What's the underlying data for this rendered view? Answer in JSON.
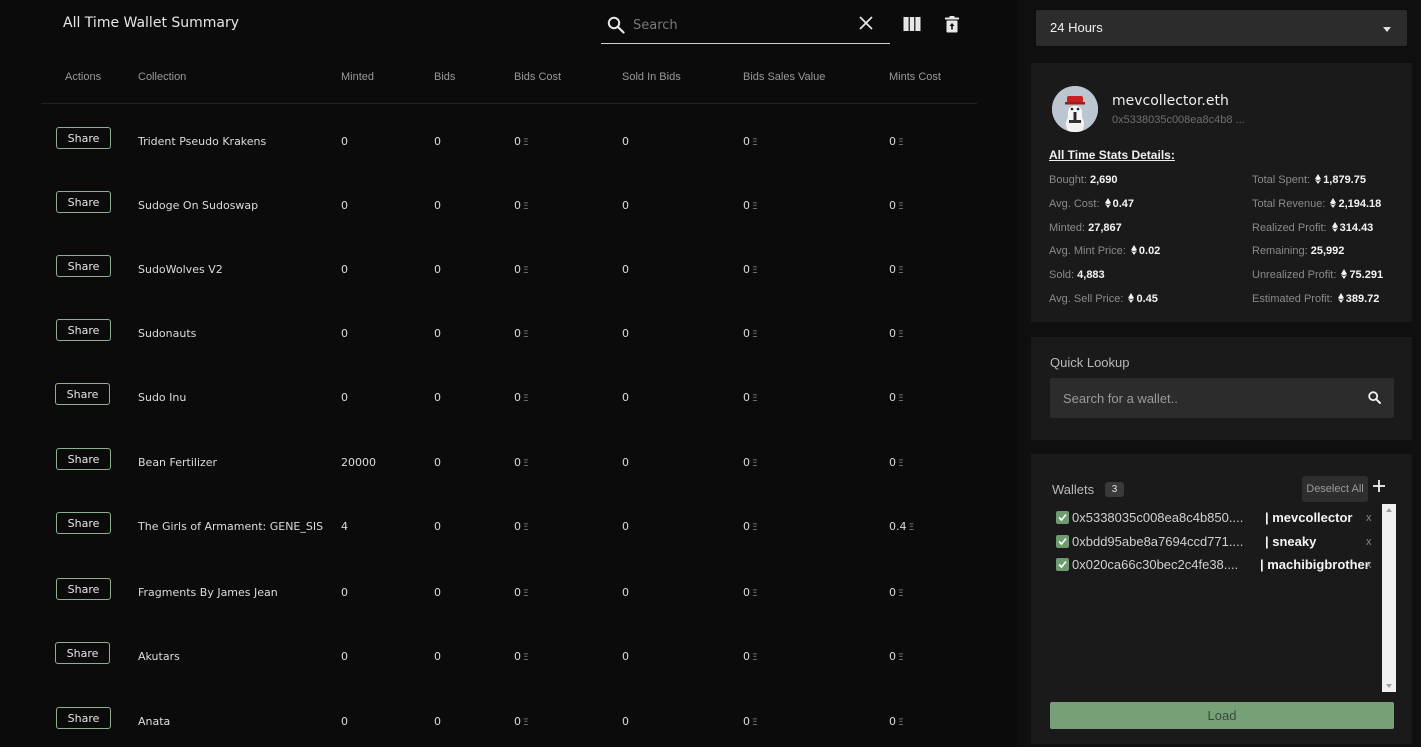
{
  "summary": {
    "title": "All Time Wallet Summary",
    "search_placeholder": "Search"
  },
  "table": {
    "headers": [
      "Actions",
      "Collection",
      "Minted",
      "Bids",
      "Bids Cost",
      "Sold In Bids",
      "Bids Sales Value",
      "Mints Cost"
    ],
    "share_label": "Share",
    "eth_symbol": "Ξ",
    "rows": [
      {
        "collection": "Trident Pseudo Krakens",
        "minted": "0",
        "bids": "0",
        "bids_cost": "0",
        "sold_in_bids": "0",
        "bids_sales_value": "0",
        "mints_cost": "0"
      },
      {
        "collection": "Sudoge On Sudoswap",
        "minted": "0",
        "bids": "0",
        "bids_cost": "0",
        "sold_in_bids": "0",
        "bids_sales_value": "0",
        "mints_cost": "0"
      },
      {
        "collection": "SudoWolves V2",
        "minted": "0",
        "bids": "0",
        "bids_cost": "0",
        "sold_in_bids": "0",
        "bids_sales_value": "0",
        "mints_cost": "0"
      },
      {
        "collection": "Sudonauts",
        "minted": "0",
        "bids": "0",
        "bids_cost": "0",
        "sold_in_bids": "0",
        "bids_sales_value": "0",
        "mints_cost": "0"
      },
      {
        "collection": "Sudo Inu",
        "minted": "0",
        "bids": "0",
        "bids_cost": "0",
        "sold_in_bids": "0",
        "bids_sales_value": "0",
        "mints_cost": "0"
      },
      {
        "collection": "Bean Fertilizer",
        "minted": "20000",
        "bids": "0",
        "bids_cost": "0",
        "sold_in_bids": "0",
        "bids_sales_value": "0",
        "mints_cost": "0"
      },
      {
        "collection": "The Girls of Armament: GENE_SIS",
        "minted": "4",
        "bids": "0",
        "bids_cost": "0",
        "sold_in_bids": "0",
        "bids_sales_value": "0",
        "mints_cost": "0.4"
      },
      {
        "collection": "Fragments By James Jean",
        "minted": "0",
        "bids": "0",
        "bids_cost": "0",
        "sold_in_bids": "0",
        "bids_sales_value": "0",
        "mints_cost": "0"
      },
      {
        "collection": "Akutars",
        "minted": "0",
        "bids": "0",
        "bids_cost": "0",
        "sold_in_bids": "0",
        "bids_sales_value": "0",
        "mints_cost": "0"
      },
      {
        "collection": "Anata",
        "minted": "0",
        "bids": "0",
        "bids_cost": "0",
        "sold_in_bids": "0",
        "bids_sales_value": "0",
        "mints_cost": "0"
      }
    ]
  },
  "period": {
    "selected": "24 Hours"
  },
  "profile": {
    "ens": "mevcollector.eth",
    "address": "0x5338035c008ea8c4b8 ...",
    "stats_title": "All Time Stats Details:",
    "left_stats": [
      {
        "label": "Bought:",
        "value": "2,690",
        "eth": false
      },
      {
        "label": "Avg. Cost:",
        "value": "0.47",
        "eth": true
      },
      {
        "label": "Minted:",
        "value": "27,867",
        "eth": false
      },
      {
        "label": "Avg. Mint Price:",
        "value": "0.02",
        "eth": true
      },
      {
        "label": "Sold:",
        "value": "4,883",
        "eth": false
      },
      {
        "label": "Avg. Sell Price:",
        "value": "0.45",
        "eth": true
      }
    ],
    "right_stats": [
      {
        "label": "Total Spent:",
        "value": "1,879.75",
        "eth": true
      },
      {
        "label": "Total Revenue:",
        "value": "2,194.18",
        "eth": true
      },
      {
        "label": "Realized Profit:",
        "value": "314.43",
        "eth": true
      },
      {
        "label": "Remaining:",
        "value": "25,992",
        "eth": false
      },
      {
        "label": "Unrealized Profit:",
        "value": "75.291",
        "eth": true
      },
      {
        "label": "Estimated Profit:",
        "value": "389.72",
        "eth": true
      }
    ]
  },
  "lookup": {
    "label": "Quick Lookup",
    "placeholder": "Search for a wallet.."
  },
  "wallets": {
    "label": "Wallets",
    "count": "3",
    "deselect_label": "Deselect All",
    "remove_label": "x",
    "items": [
      {
        "address": "0x5338035c008ea8c4b850....",
        "name": "| mevcollector"
      },
      {
        "address": "0xbdd95abe8a7694ccd771....",
        "name": "| sneaky"
      },
      {
        "address": "0x020ca66c30bec2c4fe38....",
        "name": "| machibigbrother"
      }
    ],
    "load_label": "Load"
  },
  "colors": {
    "accent_green": "#77a077",
    "panel": "#1a1a1a",
    "background": "#0b0b0b"
  },
  "icons": [
    "search-icon",
    "close-icon",
    "columns-icon",
    "trash-icon",
    "chevron-down-icon",
    "eth-icon",
    "plus-icon",
    "checkbox-checked-icon"
  ]
}
